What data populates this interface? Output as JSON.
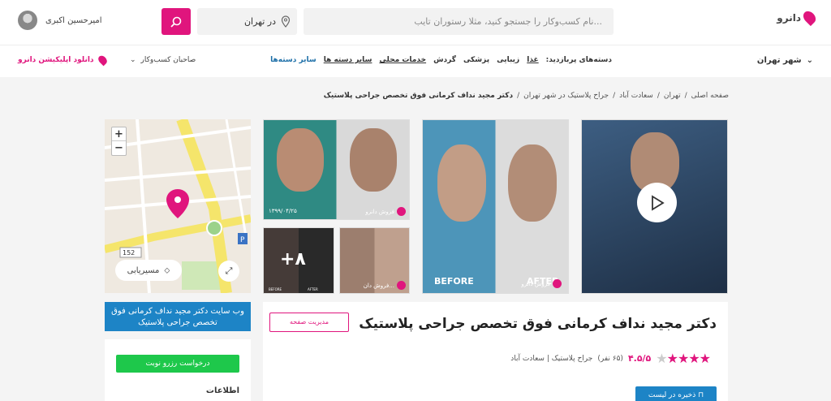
{
  "header": {
    "logo_text": "دانرو",
    "search_placeholder": "نام کسب‌وکار را جستجو کنید، مثلا رستوران تایب...",
    "city": "در تهران",
    "user_name": "امیرحسین اکبری",
    "brand_color": "#e0157d"
  },
  "nav": {
    "city": "شهر تهران",
    "categories_label": "دسته‌های پربازدید:",
    "categories": [
      "غذا",
      "زیبایی",
      "پزشکی",
      "گردش",
      "خدمات محلی",
      "سایر دسته ها"
    ],
    "other_categories": "سایر دسته‌ها",
    "owners": "صاحبان کسب‌وکار",
    "download": "دانلود اپلیکیشن دانرو"
  },
  "breadcrumb": [
    "صفحه اصلی",
    "تهران",
    "سعادت آباد",
    "جراح پلاستیک در شهر تهران",
    "دکتر مجید نداف کرمانی فوق تخصص جراحی پلاستیک"
  ],
  "map": {
    "zoom_in": "+",
    "zoom_out": "−",
    "route_label": "مسیریابی",
    "road_number": "152",
    "parking": "P"
  },
  "photos": {
    "caption": "فروش دانرو",
    "caption_short": "فروش دان...",
    "date_stamp": "۱۳۹۹/۰۴/۲۵",
    "more_count": "+۸",
    "before": "BEFORE",
    "after": "AFTER"
  },
  "sidebar": {
    "website_button": "وب سایت دکتر مجید نداف کرمانی فوق تخصص جراحی پلاستیک",
    "reserve_button": "درخواست رزرو نوبت",
    "info_label": "اطلاعات"
  },
  "business": {
    "title": "دکتر مجید نداف کرمانی فوق تخصص جراحی پلاستیک",
    "manage_button": "مدیریت صفحه",
    "rating": "۴.۵/۵",
    "rating_count": "(۶۵ نفر)",
    "category": "جراح پلاستیک | سعادت آباد",
    "save_button": "ذخیره در لیست"
  }
}
